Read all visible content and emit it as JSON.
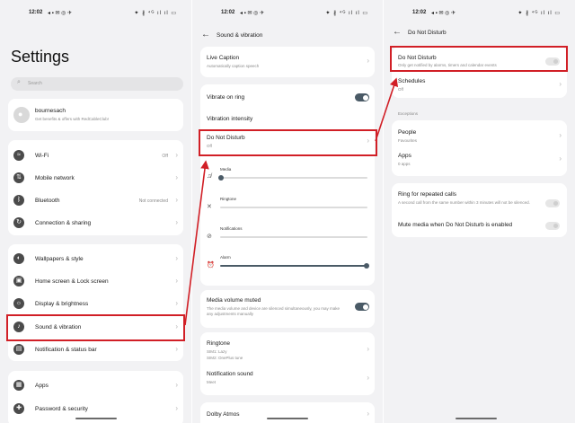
{
  "status": {
    "time": "12:02",
    "notif_icons": "◂ ▪ ✉ ◎ ✈",
    "indicators": "✦ ∦ ⁴ᴳ ıl ıl ▭"
  },
  "screen1": {
    "title": "Settings",
    "search_placeholder": "Search",
    "profile": {
      "name": "bournesach",
      "sub": "Get benefits & offers with RedCableClub!"
    },
    "group1": [
      {
        "label": "Wi-Fi",
        "value": "Off",
        "icon": "wifi-icon",
        "glyph": "≈"
      },
      {
        "label": "Mobile network",
        "value": "",
        "icon": "mobile-network-icon",
        "glyph": "⇅"
      },
      {
        "label": "Bluetooth",
        "value": "Not connected",
        "icon": "bluetooth-icon",
        "glyph": "ᛒ"
      },
      {
        "label": "Connection & sharing",
        "value": "",
        "icon": "connection-sharing-icon",
        "glyph": "↻"
      }
    ],
    "group2": [
      {
        "label": "Wallpapers & style",
        "icon": "palette-icon",
        "glyph": "◐"
      },
      {
        "label": "Home screen & Lock screen",
        "icon": "home-screen-icon",
        "glyph": "▣"
      },
      {
        "label": "Display & brightness",
        "icon": "brightness-icon",
        "glyph": "☼"
      },
      {
        "label": "Sound & vibration",
        "icon": "bell-icon",
        "glyph": "♪"
      },
      {
        "label": "Notification & status bar",
        "icon": "notification-icon",
        "glyph": "▤"
      }
    ],
    "group3": [
      {
        "label": "Apps",
        "icon": "apps-icon",
        "glyph": "▦"
      },
      {
        "label": "Password & security",
        "icon": "security-icon",
        "glyph": "✚"
      }
    ]
  },
  "screen2": {
    "title": "Sound & vibration",
    "live_caption": {
      "label": "Live Caption",
      "sub": "Automatically caption speech"
    },
    "vibrate_on_ring": "Vibrate on ring",
    "vibration_intensity": "Vibration intensity",
    "dnd": {
      "label": "Do Not Disturb",
      "sub": "Off"
    },
    "sliders": [
      {
        "label": "Media",
        "value": 0.0
      },
      {
        "label": "Ringtone",
        "value": 0.0
      },
      {
        "label": "Notifications",
        "value": 0.0
      },
      {
        "label": "Alarm",
        "value": 1.0
      }
    ],
    "media_muted": {
      "label": "Media volume muted",
      "sub": "The media volume and device are silenced simultaneously, you may make any adjustments manually"
    },
    "ringtone": {
      "label": "Ringtone",
      "sim1": "SIM1: Lazy",
      "sim2": "SIM2: OnePlus tune"
    },
    "notification_sound": {
      "label": "Notification sound",
      "value": "Meet"
    },
    "dolby": "Dolby Atmos"
  },
  "screen3": {
    "title": "Do Not Disturb",
    "dnd": {
      "label": "Do Not Disturb",
      "sub": "Only get notified by alarms, timers and calendar events"
    },
    "schedules": {
      "label": "Schedules",
      "value": "Off"
    },
    "exceptions_header": "Exceptions",
    "people": {
      "label": "People",
      "value": "Favourites"
    },
    "apps": {
      "label": "Apps",
      "value": "0 apps"
    },
    "ring_repeated": {
      "label": "Ring for repeated calls",
      "sub": "A second call from the same number within 3 minutes will not be silenced."
    },
    "mute_media": "Mute media when Do Not Disturb is enabled"
  },
  "colors": {
    "highlight": "#d11f26",
    "accent": "#4a5a66"
  }
}
